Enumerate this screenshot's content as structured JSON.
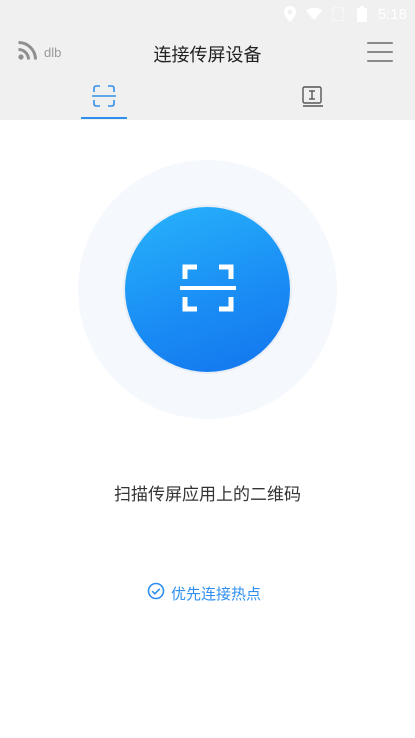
{
  "status_bar": {
    "time": "5:18",
    "icons": [
      "location-icon",
      "wifi-icon",
      "sim-icon",
      "battery-icon"
    ]
  },
  "header": {
    "device_icon": "cast-signal-icon",
    "device_name": "dlb",
    "title": "连接传屏设备",
    "menu_icon": "hamburger-menu-icon"
  },
  "tabs": [
    {
      "icon": "scan-frame-icon",
      "active": true
    },
    {
      "icon": "code-input-icon",
      "active": false
    }
  ],
  "main": {
    "scan_button_icon": "qr-scan-icon",
    "scan_label": "扫描传屏应用上的二维码",
    "hotspot_option": {
      "icon": "check-circle-icon",
      "label": "优先连接热点"
    }
  },
  "colors": {
    "accent": "#2f8ff0",
    "header_bg": "#f0f0f0",
    "scan_gradient_start": "#28b4fb",
    "scan_gradient_end": "#1274ee"
  }
}
